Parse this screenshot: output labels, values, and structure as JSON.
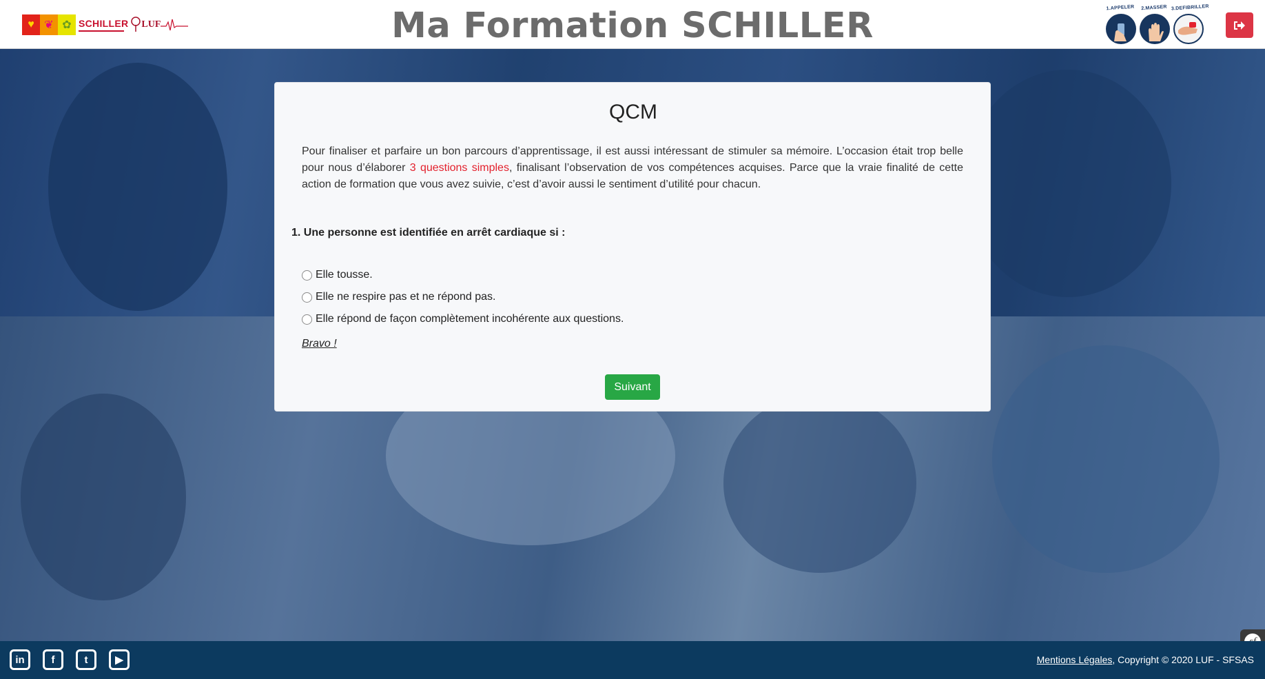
{
  "header": {
    "title": "Ma Formation SCHILLER",
    "logos": {
      "schiller_name": "SCHILLER",
      "luf": "LUF"
    },
    "steps": [
      {
        "label": "1.APPELER",
        "icon": "phone-hand-icon"
      },
      {
        "label": "2.MASSER",
        "icon": "hand-icon"
      },
      {
        "label": "3.DEFIBRILLER",
        "icon": "defibrillator-icon"
      }
    ],
    "logout_icon": "sign-out-icon"
  },
  "card": {
    "title": "QCM",
    "intro_before": "Pour finaliser et parfaire un bon parcours d’apprentissage, il est aussi intéressant de stimuler sa mémoire. L’occasion était trop belle pour nous d’élaborer ",
    "intro_highlight": "3 questions simples",
    "intro_after": ", finalisant l’observation de vos compétences acquises. Parce que la vraie finalité de cette action de formation que vous avez suivie, c’est d’avoir aussi le sentiment d’utilité pour chacun.",
    "question": "1. Une personne est identifiée en arrêt cardiaque si :",
    "options": [
      "Elle tousse.",
      "Elle ne respire pas et ne répond pas.",
      "Elle répond de façon complètement incohérente aux questions."
    ],
    "feedback": "Bravo !",
    "next_label": "Suivant"
  },
  "footer": {
    "social": [
      {
        "name": "linkedin-icon",
        "glyph": "in"
      },
      {
        "name": "facebook-icon",
        "glyph": "f"
      },
      {
        "name": "twitter-icon",
        "glyph": "t"
      },
      {
        "name": "youtube-icon",
        "glyph": "▶"
      }
    ],
    "legal_link": "Mentions Légales",
    "copyright": ", Copyright © 2020 LUF - SFSAS"
  },
  "colors": {
    "accent_red": "#dc3545",
    "highlight_red": "#e3212d",
    "button_green": "#28a745",
    "footer_navy": "#0c3a5f"
  }
}
